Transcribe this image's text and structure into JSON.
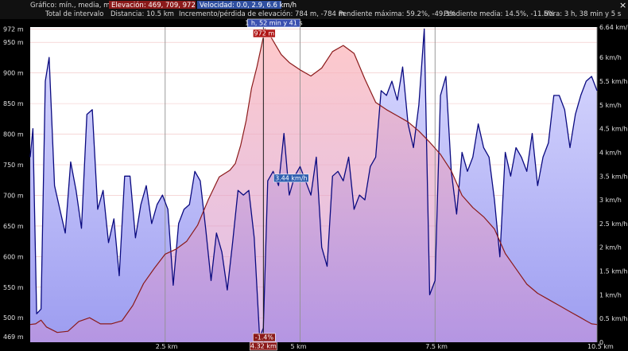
{
  "header": {
    "graph_label": "Gráfico: mín., media, máx.",
    "elevation_label": "Elevación: 469, 709, 972 m",
    "speed_label": "Velocidad: 0.0, 2.9, 6.6 km/h",
    "interval_label": "Total de intervalo",
    "distance_label": "Distancia: 10.5 km",
    "gain_label": "Incremento/pérdida de elevación: 784 m, -784 m",
    "max_slope_label": "Pendiente máxima: 59.2%, -49.3%",
    "avg_slope_label": "Pendiente media: 14.5%, -11.5%",
    "time_label": "Hora: 3 h, 38 min y 5 s",
    "close_glyph": "×",
    "close_icon": "close-icon"
  },
  "cursor": {
    "time_label": "1 h, 52 min y 41 s",
    "elevation_label": "972 m",
    "speed_label": "3.44 km/h",
    "slope_label": "-1.4%",
    "distance_label": "4.32 km",
    "distance_value": 4.32
  },
  "colors": {
    "elevation": "#8b1a1a",
    "speed": "#0a0a80",
    "speed_fill": "#9c9cf0",
    "elevation_fill": "#ffb8b8",
    "elevation_badge": "#b01818",
    "speed_badge": "#2f5fb0",
    "time_badge": "#3a4fb0",
    "slope_badge": "#8b1a1a"
  },
  "chart_data": {
    "type": "line",
    "x_unit": "km",
    "x_range": [
      0,
      10.5
    ],
    "x_ticks": [
      {
        "value": 2.5,
        "label": "2.5 km"
      },
      {
        "value": 5,
        "label": "5 km"
      },
      {
        "value": 7.5,
        "label": "7.5 km"
      },
      {
        "value": 10.5,
        "label": "10.5 km"
      }
    ],
    "y_left": {
      "unit": "m",
      "range": [
        460,
        975
      ],
      "ticks": [
        {
          "value": 972,
          "label": "972 m"
        },
        {
          "value": 950,
          "label": "950 m"
        },
        {
          "value": 900,
          "label": "900 m"
        },
        {
          "value": 850,
          "label": "850 m"
        },
        {
          "value": 800,
          "label": "800 m"
        },
        {
          "value": 750,
          "label": "750 m"
        },
        {
          "value": 700,
          "label": "700 m"
        },
        {
          "value": 650,
          "label": "650 m"
        },
        {
          "value": 600,
          "label": "600 m"
        },
        {
          "value": 550,
          "label": "550 m"
        },
        {
          "value": 500,
          "label": "500 m"
        },
        {
          "value": 469,
          "label": "469 m"
        }
      ]
    },
    "y_right": {
      "unit": "km/h",
      "range": [
        0,
        6.64
      ],
      "ticks": [
        {
          "value": 6.64,
          "label": "6.64 km/h"
        },
        {
          "value": 6,
          "label": "6 km/h"
        },
        {
          "value": 5.5,
          "label": "5.5 km/h"
        },
        {
          "value": 5,
          "label": "5 km/h"
        },
        {
          "value": 4.5,
          "label": "4.5 km/h"
        },
        {
          "value": 4,
          "label": "4 km/h"
        },
        {
          "value": 3.5,
          "label": "3.5 km/h"
        },
        {
          "value": 3,
          "label": "3 km/h"
        },
        {
          "value": 2.5,
          "label": "2.5 km/h"
        },
        {
          "value": 2,
          "label": "2 km/h"
        },
        {
          "value": 1.5,
          "label": "1.5 km/h"
        },
        {
          "value": 1,
          "label": "1 km/h"
        },
        {
          "value": 0.5,
          "label": "0.5 km/h"
        },
        {
          "value": 0,
          "label": "0"
        }
      ]
    },
    "grid": true,
    "series": [
      {
        "axis": "left",
        "x": [
          0,
          0.1,
          0.2,
          0.3,
          0.5,
          0.7,
          0.9,
          1.1,
          1.3,
          1.5,
          1.7,
          1.9,
          2.1,
          2.3,
          2.5,
          2.7,
          2.9,
          3.1,
          3.3,
          3.5,
          3.7,
          3.8,
          3.9,
          4.0,
          4.1,
          4.2,
          4.3,
          4.35,
          4.45,
          4.55,
          4.65,
          4.8,
          5.0,
          5.2,
          5.4,
          5.6,
          5.8,
          6.0,
          6.2,
          6.4,
          6.6,
          6.8,
          7.0,
          7.2,
          7.4,
          7.6,
          7.8,
          8.0,
          8.2,
          8.4,
          8.6,
          8.8,
          9.0,
          9.2,
          9.4,
          9.6,
          9.8,
          10.0,
          10.2,
          10.3,
          10.4,
          10.5
        ],
        "values": [
          489,
          490,
          496,
          485,
          476,
          478,
          494,
          500,
          490,
          490,
          495,
          520,
          556,
          581,
          604,
          612,
          625,
          651,
          693,
          730,
          741,
          752,
          782,
          822,
          875,
          910,
          951,
          972,
          960,
          945,
          930,
          917,
          905,
          895,
          908,
          935,
          945,
          932,
          890,
          852,
          840,
          830,
          820,
          805,
          787,
          767,
          740,
          700,
          680,
          665,
          645,
          605,
          580,
          555,
          540,
          530,
          520,
          510,
          500,
          495,
          490,
          489
        ]
      },
      {
        "axis": "right",
        "x": [
          0,
          0.05,
          0.12,
          0.2,
          0.28,
          0.35,
          0.45,
          0.55,
          0.65,
          0.75,
          0.85,
          0.95,
          1.05,
          1.15,
          1.25,
          1.35,
          1.45,
          1.55,
          1.65,
          1.75,
          1.85,
          1.95,
          2.05,
          2.15,
          2.25,
          2.35,
          2.45,
          2.55,
          2.65,
          2.75,
          2.85,
          2.95,
          3.05,
          3.15,
          3.25,
          3.35,
          3.45,
          3.55,
          3.65,
          3.75,
          3.85,
          3.95,
          4.05,
          4.15,
          4.25,
          4.32,
          4.4,
          4.5,
          4.6,
          4.7,
          4.8,
          4.9,
          5.0,
          5.1,
          5.2,
          5.3,
          5.4,
          5.5,
          5.6,
          5.7,
          5.8,
          5.9,
          6.0,
          6.1,
          6.2,
          6.3,
          6.4,
          6.5,
          6.6,
          6.7,
          6.8,
          6.9,
          7.0,
          7.1,
          7.2,
          7.3,
          7.4,
          7.5,
          7.6,
          7.7,
          7.8,
          7.9,
          8.0,
          8.1,
          8.2,
          8.3,
          8.4,
          8.5,
          8.6,
          8.7,
          8.8,
          8.9,
          9.0,
          9.1,
          9.2,
          9.3,
          9.4,
          9.5,
          9.6,
          9.7,
          9.8,
          9.9,
          10.0,
          10.1,
          10.2,
          10.3,
          10.4,
          10.5
        ],
        "values": [
          3.9,
          4.5,
          0.6,
          0.7,
          5.5,
          6.0,
          3.3,
          2.8,
          2.3,
          3.8,
          3.2,
          2.4,
          4.8,
          4.9,
          2.8,
          3.2,
          2.1,
          2.6,
          1.4,
          3.5,
          3.5,
          2.2,
          2.9,
          3.3,
          2.5,
          2.9,
          3.1,
          2.8,
          1.2,
          2.5,
          2.8,
          2.9,
          3.6,
          3.4,
          2.4,
          1.3,
          2.3,
          1.9,
          1.1,
          2.1,
          3.2,
          3.1,
          3.2,
          2.2,
          0.1,
          0.3,
          3.4,
          3.6,
          3.3,
          4.4,
          3.1,
          3.5,
          3.7,
          3.4,
          3.1,
          3.9,
          2.0,
          1.6,
          3.5,
          3.6,
          3.4,
          3.9,
          2.8,
          3.1,
          3.0,
          3.7,
          3.9,
          5.3,
          5.2,
          5.5,
          5.1,
          5.8,
          4.6,
          4.1,
          5.0,
          6.6,
          1.0,
          1.3,
          5.2,
          5.6,
          3.6,
          2.7,
          4.0,
          3.6,
          3.9,
          4.6,
          4.1,
          3.9,
          3.0,
          1.8,
          4.0,
          3.5,
          4.1,
          3.9,
          3.6,
          4.4,
          3.3,
          3.9,
          4.2,
          5.2,
          5.2,
          4.9,
          4.1,
          4.8,
          5.2,
          5.5,
          5.6,
          5.3
        ]
      }
    ]
  }
}
